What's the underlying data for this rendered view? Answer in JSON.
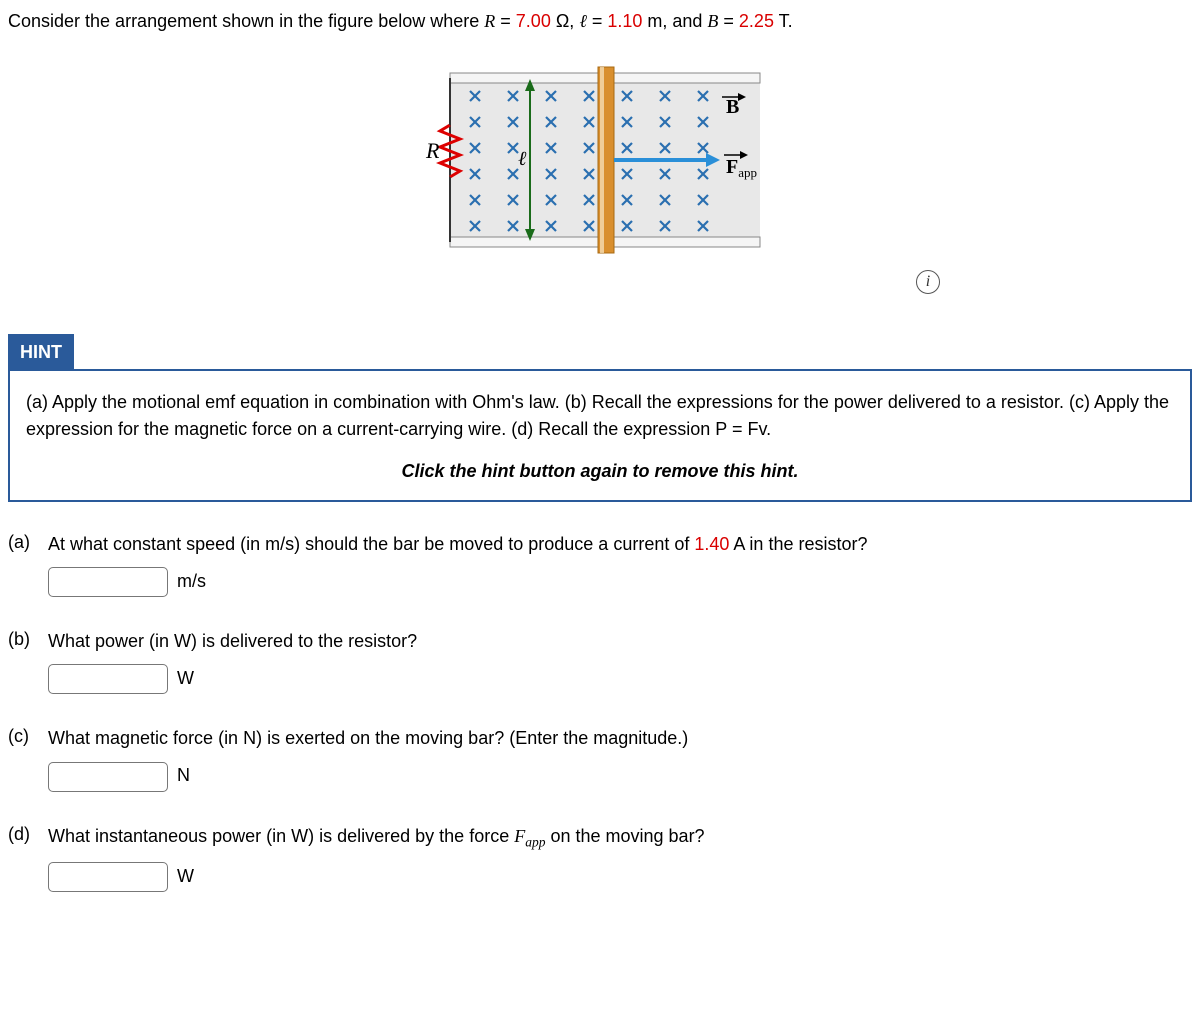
{
  "prompt": {
    "pre": "Consider the arrangement shown in the figure below where ",
    "R_label": "R",
    "eq": " = ",
    "R_val": "7.00",
    "R_unit": " Ω, ",
    "l_label": "ℓ",
    "l_val": "1.10",
    "l_unit": " m, and ",
    "B_label": "B",
    "B_val": "2.25",
    "B_unit": " T."
  },
  "figure": {
    "R": "R",
    "l": "ℓ",
    "B": "B",
    "Fapp": "F",
    "Fapp_sub": "app"
  },
  "hint_button": "HINT",
  "hint_body": "(a) Apply the motional emf equation in combination with Ohm's law. (b) Recall the expressions for the power delivered to a resistor. (c) Apply the expression for the magnetic force on a current-carrying wire. (d) Recall the expression P = Fv.",
  "hint_footer": "Click the hint button again to remove this hint.",
  "questions": {
    "a": {
      "label": "(a)",
      "pre": "At what constant speed (in m/s) should the bar be moved to produce a current of ",
      "val": "1.40",
      "post": " A in the resistor?",
      "unit": "m/s"
    },
    "b": {
      "label": "(b)",
      "text": "What power (in W) is delivered to the resistor?",
      "unit": "W"
    },
    "c": {
      "label": "(c)",
      "text": "What magnetic force (in N) is exerted on the moving bar? (Enter the magnitude.)",
      "unit": "N"
    },
    "d": {
      "label": "(d)",
      "pre": "What instantaneous power (in W) is delivered by the force ",
      "F": "F",
      "Fsub": "app",
      "post": " on the moving bar?",
      "unit": "W"
    }
  }
}
